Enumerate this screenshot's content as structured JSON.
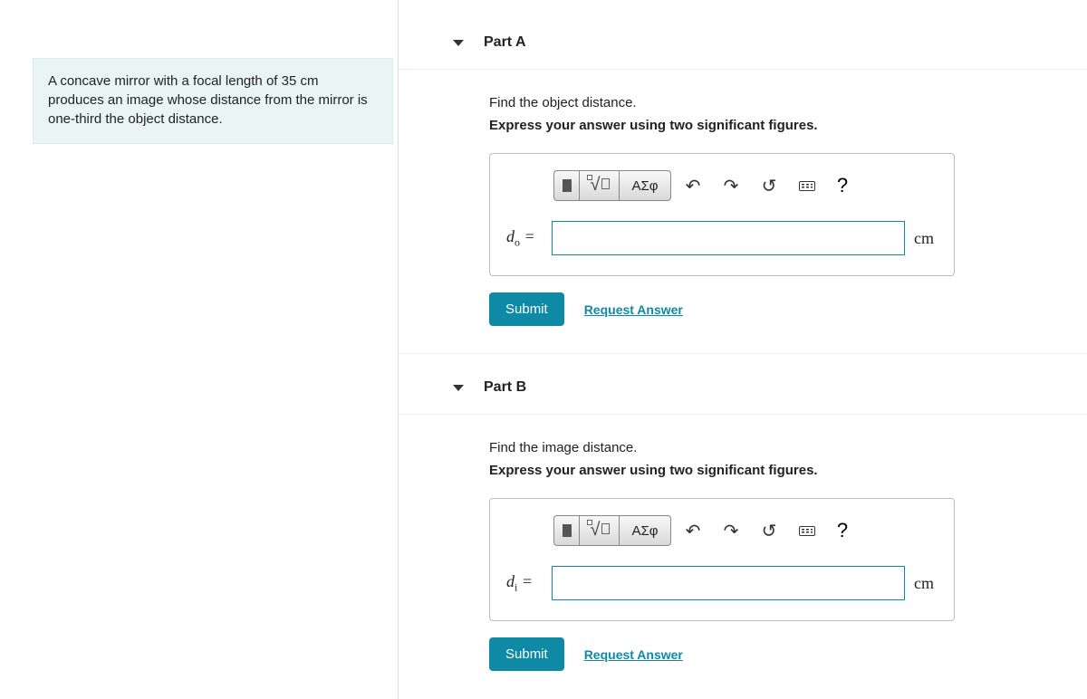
{
  "problem_statement": "A concave mirror with a focal length of 35 cm produces an image whose distance from the mirror is one-third the object distance.",
  "toolbar": {
    "greek_label": "ΑΣφ",
    "undo_glyph": "↶",
    "redo_glyph": "↷",
    "reset_glyph": "↺",
    "help_glyph": "?"
  },
  "parts": [
    {
      "title": "Part A",
      "prompt": "Find the object distance.",
      "instruction": "Express your answer using two significant figures.",
      "var_html": "d<sub>o</sub> =",
      "value": "",
      "unit": "cm",
      "submit_label": "Submit",
      "request_label": "Request Answer"
    },
    {
      "title": "Part B",
      "prompt": "Find the image distance.",
      "instruction": "Express your answer using two significant figures.",
      "var_html": "d<sub>i</sub> =",
      "value": "",
      "unit": "cm",
      "submit_label": "Submit",
      "request_label": "Request Answer"
    }
  ]
}
